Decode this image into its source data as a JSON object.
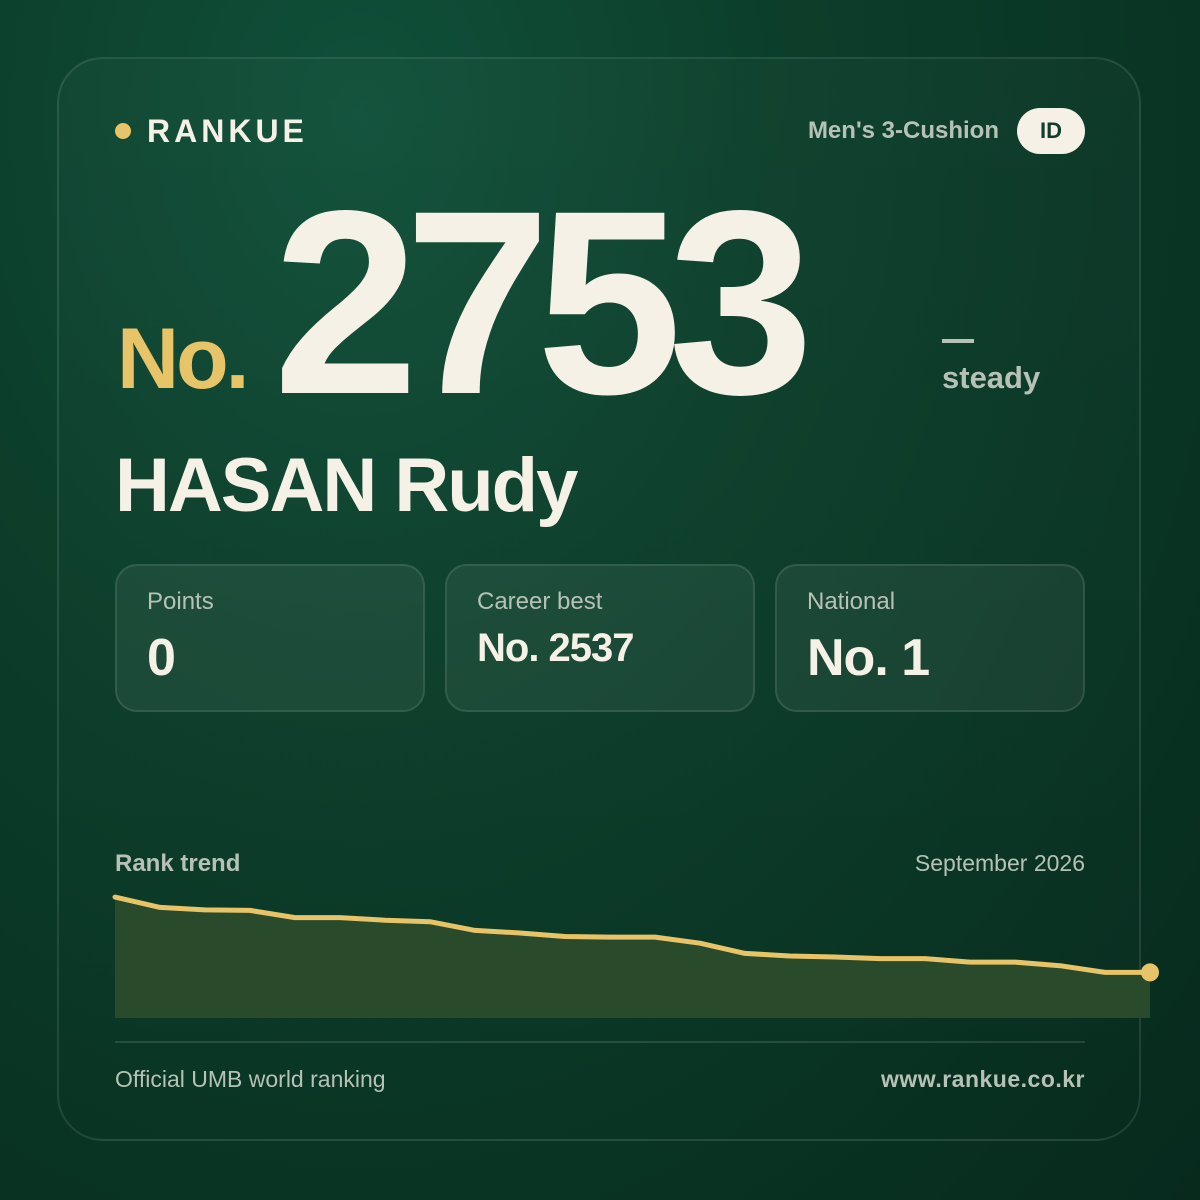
{
  "brand": {
    "name": "RANKUE",
    "dot_color": "#e8c468"
  },
  "header": {
    "category": "Men's 3-Cushion",
    "country_code": "ID"
  },
  "rank": {
    "prefix": "No.",
    "number": "2753",
    "trend_symbol": "—",
    "trend_label": "steady"
  },
  "player": {
    "name": "HASAN Rudy"
  },
  "stats": [
    {
      "label": "Points",
      "value": "0"
    },
    {
      "label": "Career best",
      "value": "No. 2537"
    },
    {
      "label": "National",
      "value": "No. 1"
    }
  ],
  "trend": {
    "title": "Rank trend",
    "date": "September 2026"
  },
  "footer": {
    "source": "Official UMB world ranking",
    "url": "www.rankue.co.kr"
  },
  "colors": {
    "accent": "#e8c468",
    "background": "#0c3f2b",
    "text": "#f5f1e6",
    "muted": "#b7c2b6",
    "area_fill": "#2a4a2c"
  },
  "chart_data": {
    "type": "area",
    "x": [
      1,
      2,
      3,
      4,
      5,
      6,
      7,
      8,
      9,
      10,
      11,
      12,
      13,
      14,
      15,
      16,
      17,
      18,
      19,
      20,
      21,
      22,
      23,
      24
    ],
    "values": [
      3020,
      3000,
      2995,
      2994,
      2980,
      2980,
      2975,
      2972,
      2955,
      2950,
      2943,
      2942,
      2942,
      2930,
      2910,
      2905,
      2903,
      2900,
      2900,
      2893,
      2893,
      2886,
      2873,
      2873
    ],
    "ylim": [
      2780,
      3030
    ],
    "y_inverted": false,
    "grid": false,
    "legend": "none"
  }
}
